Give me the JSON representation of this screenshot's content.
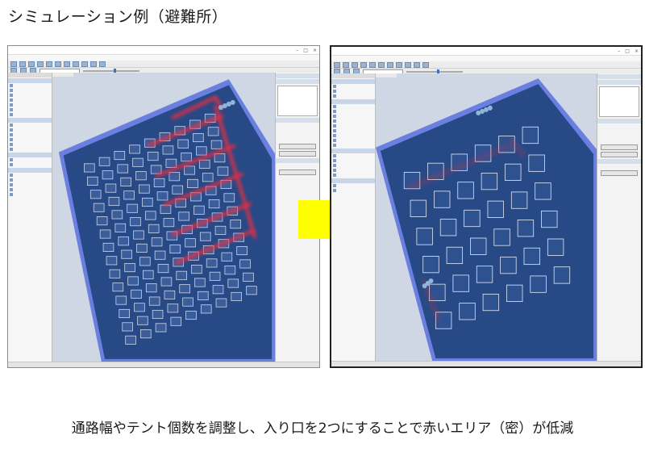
{
  "slide": {
    "title": "シミュレーション例（避難所）",
    "caption": "通路幅やテント個数を調整し、入り口を2つにすることで赤いエリア（密）が低減"
  },
  "colors": {
    "floor": "#274a86",
    "floor_edge": "#6a7fe0",
    "density_red": "#ff2a3a",
    "arrow": "#ffff00",
    "viewport_bg": "#cfd6e4"
  }
}
